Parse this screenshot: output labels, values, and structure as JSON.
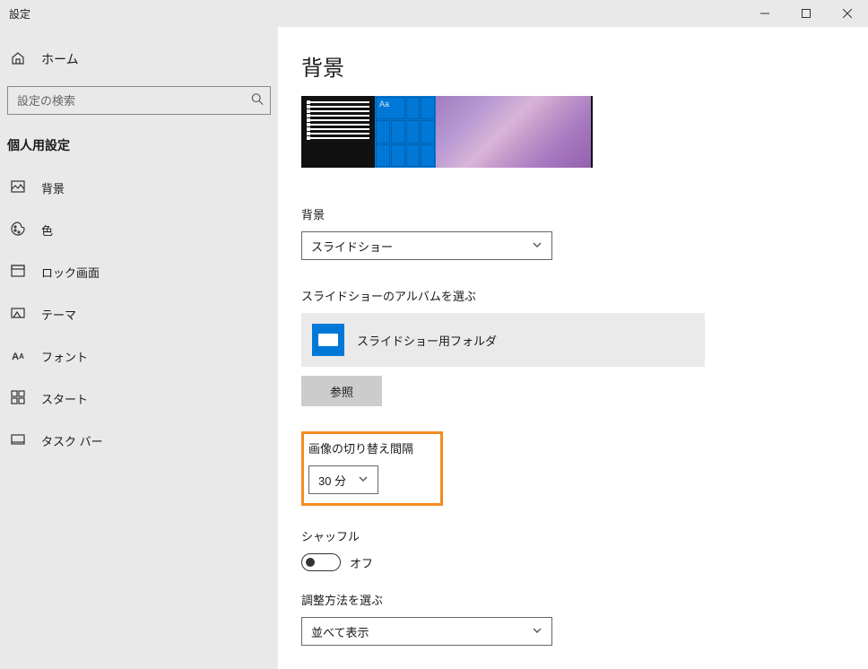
{
  "window": {
    "title": "設定"
  },
  "sidebar": {
    "home": "ホーム",
    "search_placeholder": "設定の検索",
    "section_title": "個人用設定",
    "items": [
      {
        "label": "背景"
      },
      {
        "label": "色"
      },
      {
        "label": "ロック画面"
      },
      {
        "label": "テーマ"
      },
      {
        "label": "フォント"
      },
      {
        "label": "スタート"
      },
      {
        "label": "タスク バー"
      }
    ]
  },
  "page": {
    "title": "背景",
    "background_label": "背景",
    "background_value": "スライドショー",
    "album_label": "スライドショーのアルバムを選ぶ",
    "album_name": "スライドショー用フォルダ",
    "browse": "参照",
    "interval_label": "画像の切り替え間隔",
    "interval_value": "30 分",
    "shuffle_label": "シャッフル",
    "shuffle_value": "オフ",
    "fit_label": "調整方法を選ぶ",
    "fit_value": "並べて表示",
    "preview_tile_text": "Aa"
  }
}
